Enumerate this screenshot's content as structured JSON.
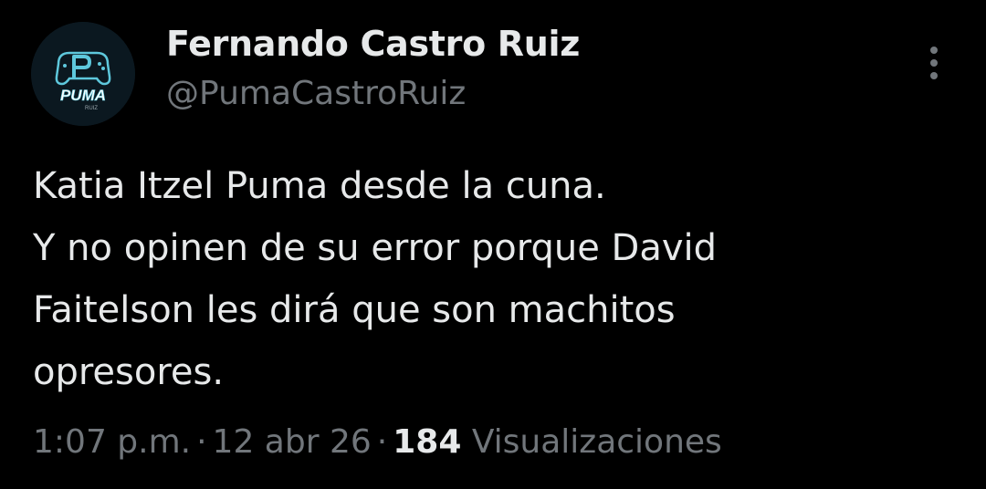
{
  "author": {
    "display_name": "Fernando Castro Ruiz",
    "handle": "@PumaCastroRuiz",
    "avatar_text": "PUMA",
    "avatar_subtext": "RUIZ",
    "avatar_icon": "gamepad-icon"
  },
  "more_icon": "more-vertical-icon",
  "tweet": {
    "lines": [
      "Katia Itzel Puma desde la cuna.",
      "Y no opinen de su error porque David",
      "Faitelson les dirá que son machitos",
      "opresores."
    ]
  },
  "meta": {
    "time": "1:07 p.m.",
    "separator": "·",
    "date": "12 abr 26",
    "views_count": "184",
    "views_label": "Visualizaciones"
  },
  "colors": {
    "background": "#000000",
    "primary_text": "#e7e9ea",
    "secondary_text": "#71767b",
    "avatar_accent": "#5ec8dc"
  }
}
